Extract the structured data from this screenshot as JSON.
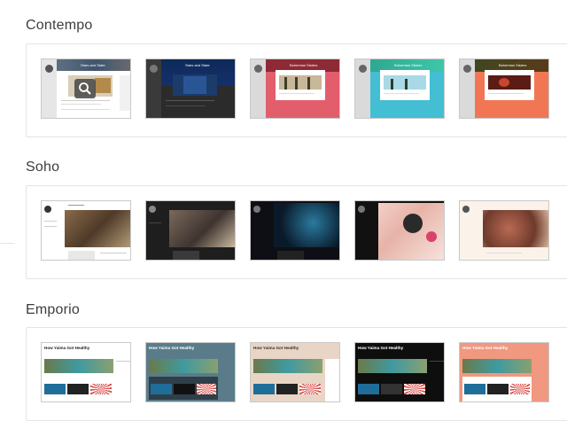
{
  "sections": [
    {
      "title": "Contempo",
      "themes": [
        {
          "variant": "light",
          "colors": {
            "accent": "#4c6a8e",
            "bg": "#ffffff",
            "sidebar": "#e8e8e8"
          }
        },
        {
          "variant": "dark",
          "colors": {
            "accent": "#1a3b6e",
            "bg": "#2a2a2a",
            "sidebar": "#3a3a3a"
          }
        },
        {
          "variant": "pink",
          "colors": {
            "accent": "#a73246",
            "bg": "#e25e6d",
            "sidebar": "#d5d5d5"
          }
        },
        {
          "variant": "teal",
          "colors": {
            "accent": "#2d8f8c",
            "bg": "#43bed2",
            "sidebar": "#d5d5d5"
          }
        },
        {
          "variant": "orange",
          "colors": {
            "accent": "#5b1a12",
            "bg": "#f17754",
            "sidebar": "#d5d5d5"
          }
        }
      ]
    },
    {
      "title": "Soho",
      "themes": [
        {
          "variant": "light",
          "colors": {
            "bg": "#ffffff",
            "hero": "#7a5a3a"
          }
        },
        {
          "variant": "dark",
          "colors": {
            "bg": "#1e1e1e",
            "hero": "#5a4a3e"
          }
        },
        {
          "variant": "night",
          "colors": {
            "bg": "#101014",
            "hero": "#1a4d6a"
          }
        },
        {
          "variant": "pastel",
          "colors": {
            "bg": "#111111",
            "hero": "#f1c9c2"
          }
        },
        {
          "variant": "cream",
          "colors": {
            "bg": "#fbf2ea",
            "hero": "#7e4a3a"
          }
        }
      ]
    },
    {
      "title": "Emporio",
      "post_title": "How Yaima Got Healthy",
      "themes": [
        {
          "variant": "light",
          "colors": {
            "bg": "#ffffff",
            "title": "#222222"
          }
        },
        {
          "variant": "slate",
          "colors": {
            "bg": "#5a7c8a",
            "title": "#ffffff"
          }
        },
        {
          "variant": "sand",
          "colors": {
            "bg": "#e8d5c5",
            "title": "#333333"
          }
        },
        {
          "variant": "black",
          "colors": {
            "bg": "#0e0e0e",
            "title": "#ffffff"
          }
        },
        {
          "variant": "coral",
          "colors": {
            "bg": "#f09880",
            "title": "#ffffff"
          }
        }
      ]
    }
  ],
  "icons": {
    "preview": "magnifier-icon"
  },
  "hover_index": 0
}
